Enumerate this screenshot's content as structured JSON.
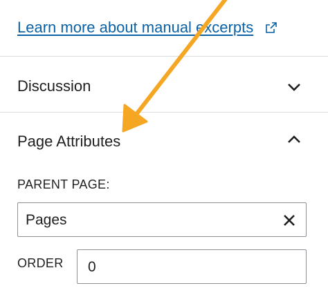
{
  "excerpt": {
    "link_label": "Learn more about manual excerpts"
  },
  "discussion_panel": {
    "title": "Discussion",
    "expanded": false
  },
  "page_attributes_panel": {
    "title": "Page Attributes",
    "expanded": true,
    "parent_page": {
      "label": "PARENT PAGE:",
      "value": "Pages"
    },
    "order": {
      "label": "ORDER",
      "value": "0"
    }
  },
  "colors": {
    "link": "#0a61a5",
    "text": "#1e1e1e",
    "divider": "#dcdcde",
    "input_border": "#8c8f94",
    "annotation_arrow": "#f5a623"
  },
  "icons": {
    "external_link": "external-link-icon",
    "collapsed": "chevron-down-icon",
    "expanded": "chevron-up-icon",
    "clear": "close-icon",
    "annotation": "annotation-arrow"
  }
}
